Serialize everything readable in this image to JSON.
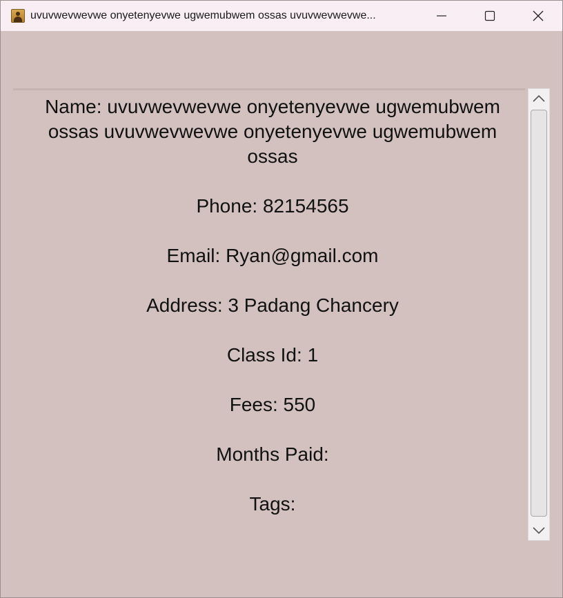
{
  "window": {
    "title": "uvuvwevwevwe onyetenyevwe ugwemubwem ossas uvuvwevwevwe...",
    "icon": "address-book-icon"
  },
  "controls": {
    "minimize": "minimize-icon",
    "maximize": "maximize-icon",
    "close": "close-icon"
  },
  "details": {
    "name": "Name: uvuvwevwevwe onyetenyevwe ugwemubwem ossas uvuvwevwevwe onyetenyevwe ugwemubwem ossas",
    "phone": "Phone: 82154565",
    "email": "Email: Ryan@gmail.com",
    "address": "Address: 3 Padang Chancery",
    "class_id": "Class Id: 1",
    "fees": "Fees: 550",
    "months_paid": "Months Paid:",
    "tags": "Tags:"
  },
  "colors": {
    "background": "#d3c1bf",
    "titlebar": "#f9eef3"
  }
}
